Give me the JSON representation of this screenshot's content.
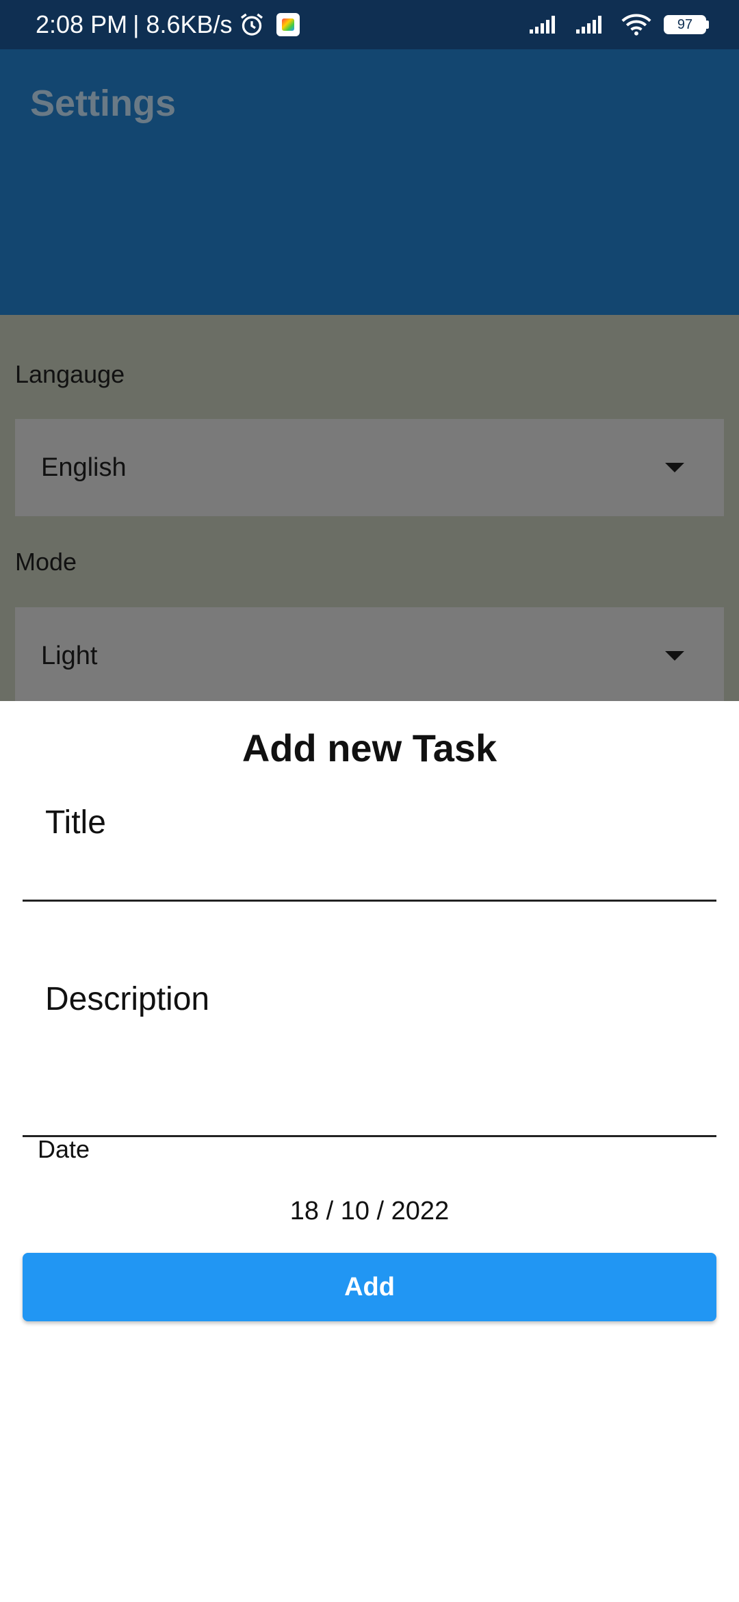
{
  "status_bar": {
    "time": "2:08 PM",
    "speed": "| 8.6KB/s",
    "battery": "97",
    "icons": [
      "alarm-icon",
      "app-icon",
      "signal-icon",
      "signal-icon",
      "wifi-icon",
      "battery-icon"
    ]
  },
  "app_bar": {
    "title": "Settings"
  },
  "settings": {
    "language_label": "Langauge",
    "language_value": "English",
    "mode_label": "Mode",
    "mode_value": "Light"
  },
  "sheet": {
    "title": "Add new Task",
    "title_field_label": "Title",
    "description_field_label": "Description",
    "date_label": "Date",
    "date_value": "18 / 10 / 2022",
    "add_button_label": "Add"
  },
  "colors": {
    "status_bar": "#0f2f52",
    "app_bar": "#134670",
    "scrim_body": "#6b6e65",
    "dropdown": "#7a7a7a",
    "button": "#2196f3"
  }
}
